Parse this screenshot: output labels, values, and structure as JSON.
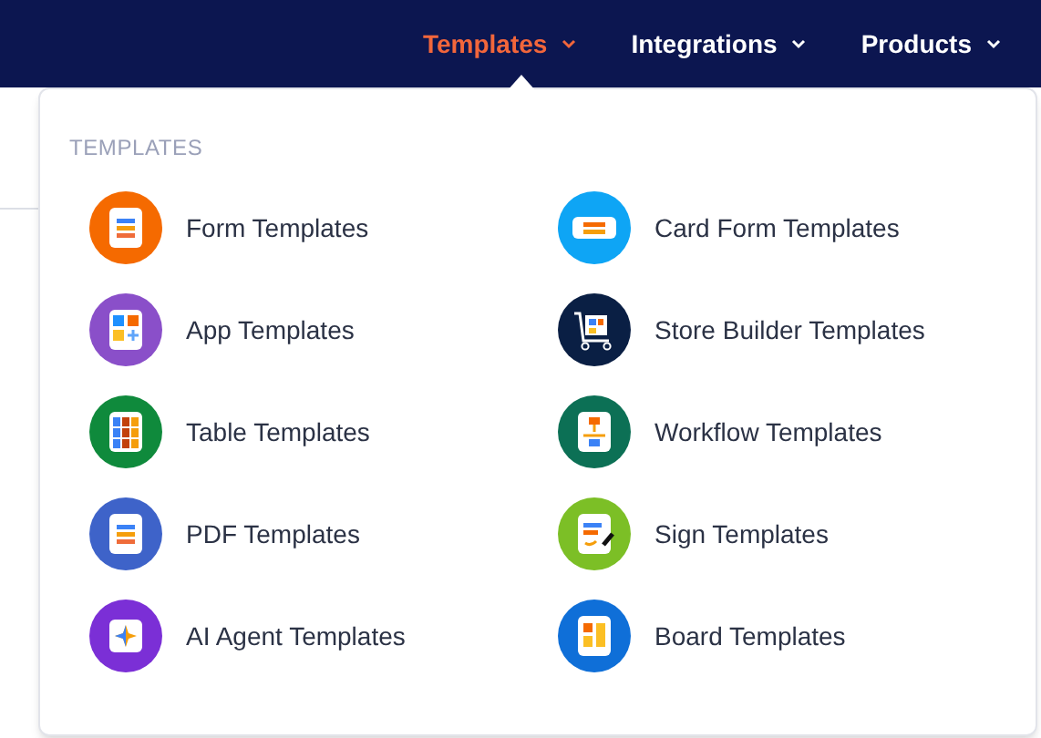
{
  "nav": [
    {
      "label": "Templates",
      "selected": true
    },
    {
      "label": "Integrations",
      "selected": false
    },
    {
      "label": "Products",
      "selected": false
    }
  ],
  "dropdown": {
    "heading": "TEMPLATES",
    "items": [
      {
        "label": "Form Templates",
        "kind": "form",
        "color": "#f56a00"
      },
      {
        "label": "Card Form Templates",
        "kind": "card",
        "color": "#0ea5f5"
      },
      {
        "label": "App Templates",
        "kind": "app",
        "color": "#8a4fc9"
      },
      {
        "label": "Store Builder Templates",
        "kind": "store",
        "color": "#0a1f44"
      },
      {
        "label": "Table Templates",
        "kind": "table",
        "color": "#0f8a3c"
      },
      {
        "label": "Workflow Templates",
        "kind": "workflow",
        "color": "#0c7055"
      },
      {
        "label": "PDF Templates",
        "kind": "pdf",
        "color": "#3e63c9"
      },
      {
        "label": "Sign Templates",
        "kind": "sign",
        "color": "#7cbf26"
      },
      {
        "label": "AI Agent Templates",
        "kind": "agent",
        "color": "#7b2fd6"
      },
      {
        "label": "Board Templates",
        "kind": "board",
        "color": "#0f6fd8"
      }
    ]
  }
}
